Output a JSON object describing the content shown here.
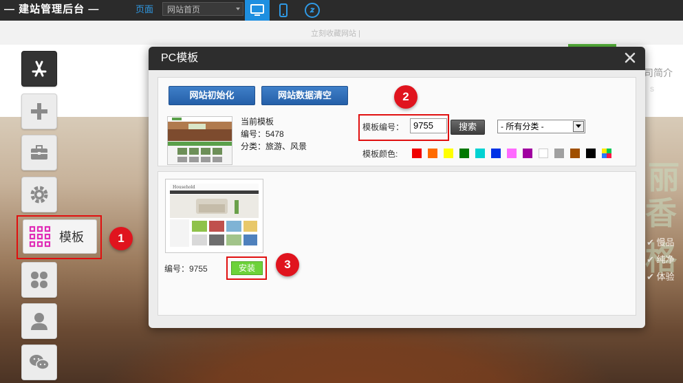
{
  "topbar": {
    "brand": "— 建站管理后台 —",
    "page_label": "页面",
    "page_select": "网站首页",
    "icons": [
      "desktop-icon",
      "mobile-icon",
      "link-icon"
    ]
  },
  "background": {
    "strip_text": "立刻收藏网站 |",
    "nav_text": "司简介",
    "nav_sub": "S",
    "side_items": [
      "✔ 慢品",
      "✔ 纯净",
      "✔ 体验"
    ],
    "big_text_1": "丽",
    "big_text_2": "香格"
  },
  "sidebar": {
    "template_label": "模板",
    "icons": [
      "app-store-icon",
      "plus-icon",
      "toolbox-icon",
      "gear-icon",
      "grid-icon",
      "clover-icon",
      "user-icon",
      "wechat-icon"
    ]
  },
  "markers": [
    "1",
    "2",
    "3"
  ],
  "dialog": {
    "title": "PC模板",
    "init_button": "网站初始化",
    "clear_button": "网站数据清空",
    "current": {
      "title": "当前模板",
      "number": "编号：5478",
      "category": "分类：旅游、风景"
    },
    "search": {
      "label": "模板编号：",
      "value": "9755",
      "button": "搜索",
      "category_select": "- 所有分类 -"
    },
    "colors": {
      "label": "模板颜色:",
      "swatches": [
        "#f00000",
        "#ff6a00",
        "#ffff00",
        "#007800",
        "#00d2d2",
        "#0032e6",
        "#ff6aff",
        "#a000a0",
        "#ffffff",
        "#a0a0a0",
        "#a05000",
        "#000000",
        "multicolor"
      ]
    },
    "result": {
      "number": "编号：9755",
      "install_button": "安装"
    }
  }
}
